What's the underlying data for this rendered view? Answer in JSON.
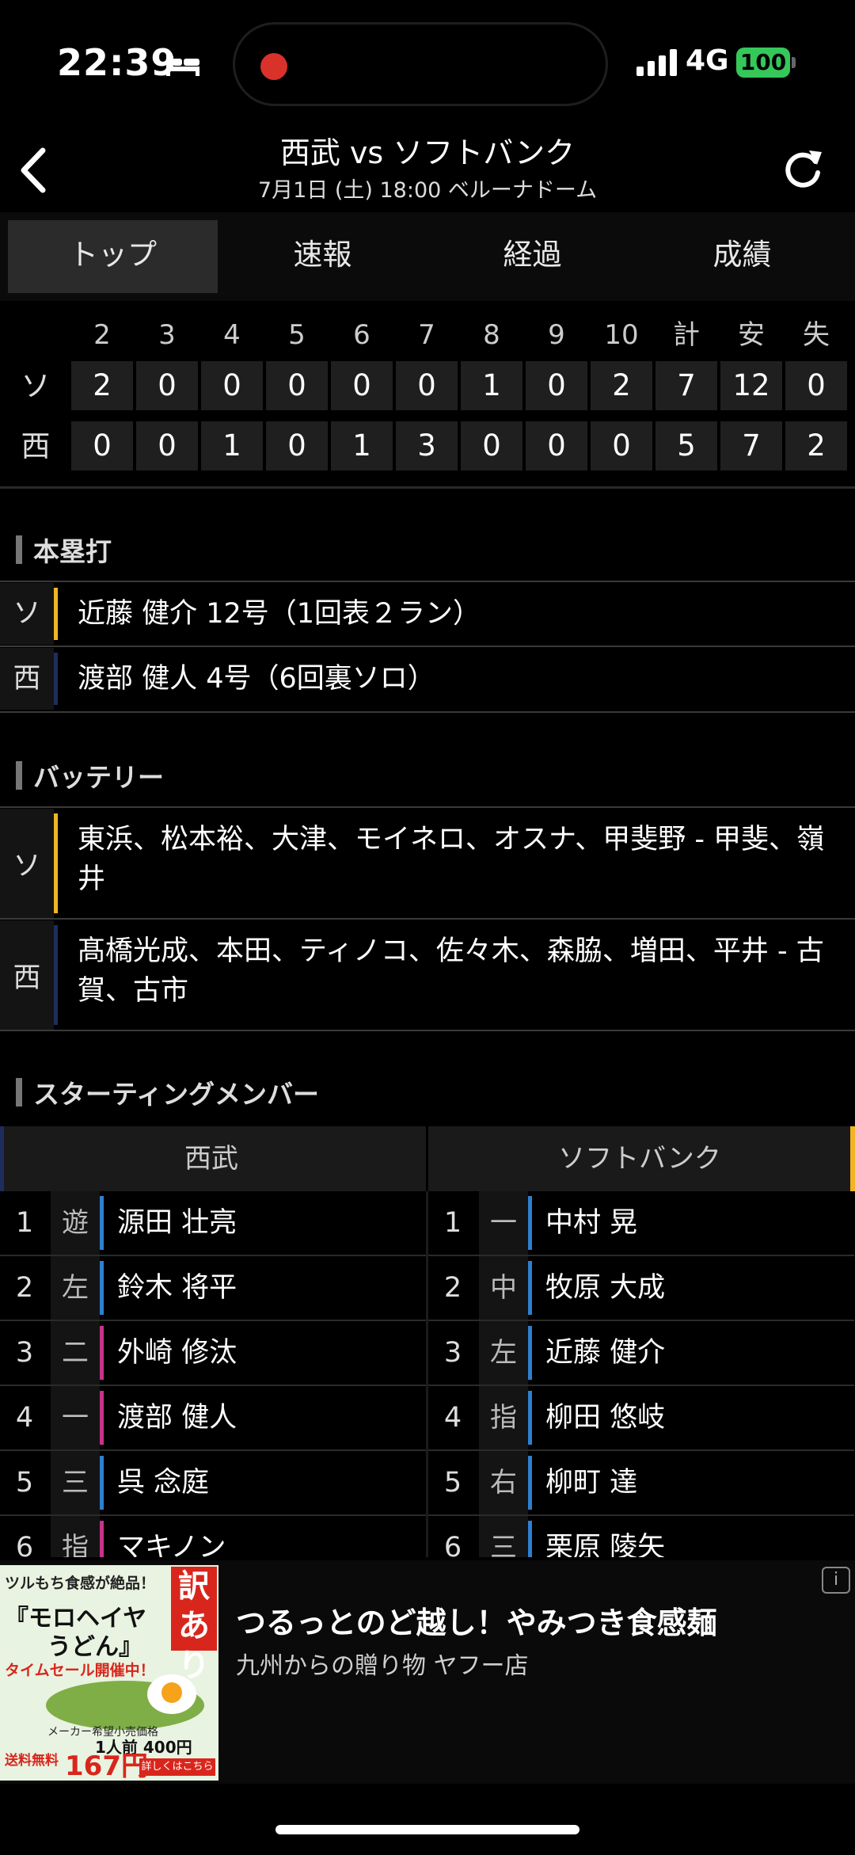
{
  "status_bar": {
    "time": "22:39",
    "network": "4G",
    "battery": "100"
  },
  "header": {
    "title": "西武 vs ソフトバンク",
    "subtitle": "7月1日 (土) 18:00 ベルーナドーム"
  },
  "tabs": [
    {
      "label": "トップ",
      "active": true
    },
    {
      "label": "速報",
      "active": false
    },
    {
      "label": "経過",
      "active": false
    },
    {
      "label": "成績",
      "active": false
    }
  ],
  "scoreboard": {
    "headers": [
      "2",
      "3",
      "4",
      "5",
      "6",
      "7",
      "8",
      "9",
      "10",
      "計",
      "安",
      "失"
    ],
    "rows": [
      {
        "team": "ソ",
        "cells": [
          "2",
          "0",
          "0",
          "0",
          "0",
          "0",
          "1",
          "0",
          "2",
          "7",
          "12",
          "0"
        ]
      },
      {
        "team": "西",
        "cells": [
          "0",
          "0",
          "1",
          "0",
          "1",
          "3",
          "0",
          "0",
          "0",
          "5",
          "7",
          "2"
        ]
      }
    ]
  },
  "homeruns": {
    "title": "本塁打",
    "items": [
      {
        "team": "ソ",
        "text": "近藤 健介 12号（1回表２ラン）",
        "color": "#f2b424"
      },
      {
        "team": "西",
        "text": "渡部 健人 4号（6回裏ソロ）",
        "color": "#1f2d5c"
      }
    ]
  },
  "battery_section": {
    "title": "バッテリー",
    "items": [
      {
        "team": "ソ",
        "text": "東浜、松本裕、大津、モイネロ、オスナ、甲斐野 - 甲斐、嶺井"
      },
      {
        "team": "西",
        "text": "髙橋光成、本田、ティノコ、佐々木、森脇、増田、平井 - 古賀、古市"
      }
    ]
  },
  "starting_members": {
    "title": "スターティングメンバー",
    "home_team": "西武",
    "away_team": "ソフトバンク",
    "home": [
      {
        "order": "1",
        "pos": "遊",
        "name": "源田 壮亮",
        "color": "#2f7fd0"
      },
      {
        "order": "2",
        "pos": "左",
        "name": "鈴木 将平",
        "color": "#2f7fd0"
      },
      {
        "order": "3",
        "pos": "二",
        "name": "外崎 修汰",
        "color": "#c8328a"
      },
      {
        "order": "4",
        "pos": "一",
        "name": "渡部 健人",
        "color": "#c8328a"
      },
      {
        "order": "5",
        "pos": "三",
        "name": "呉 念庭",
        "color": "#2f7fd0"
      },
      {
        "order": "6",
        "pos": "指",
        "name": "マキノン",
        "color": "#c8328a"
      }
    ],
    "away": [
      {
        "order": "1",
        "pos": "一",
        "name": "中村 晃",
        "color": "#2f7fd0"
      },
      {
        "order": "2",
        "pos": "中",
        "name": "牧原 大成",
        "color": "#2f7fd0"
      },
      {
        "order": "3",
        "pos": "左",
        "name": "近藤 健介",
        "color": "#2f7fd0"
      },
      {
        "order": "4",
        "pos": "指",
        "name": "柳田 悠岐",
        "color": "#2f7fd0"
      },
      {
        "order": "5",
        "pos": "右",
        "name": "柳町 達",
        "color": "#2f7fd0"
      },
      {
        "order": "6",
        "pos": "三",
        "name": "栗原 陵矢",
        "color": "#2f7fd0"
      }
    ]
  },
  "ad": {
    "title": "つるっとのど越し！やみつき食感麺",
    "sponsor": "九州からの贈り物 ヤフー店",
    "image_text": {
      "line1": "ツルもち食感が絶品！",
      "line2": "『モロヘイヤ",
      "line3": "うどん』",
      "badge": "訳あり",
      "line4": "タイムセール開催中！",
      "note": "メーカー希望小売価格",
      "old_price": "1人前 400円",
      "shipping": "送料無料",
      "price": "167円",
      "cta": "詳しくはこちら"
    }
  }
}
